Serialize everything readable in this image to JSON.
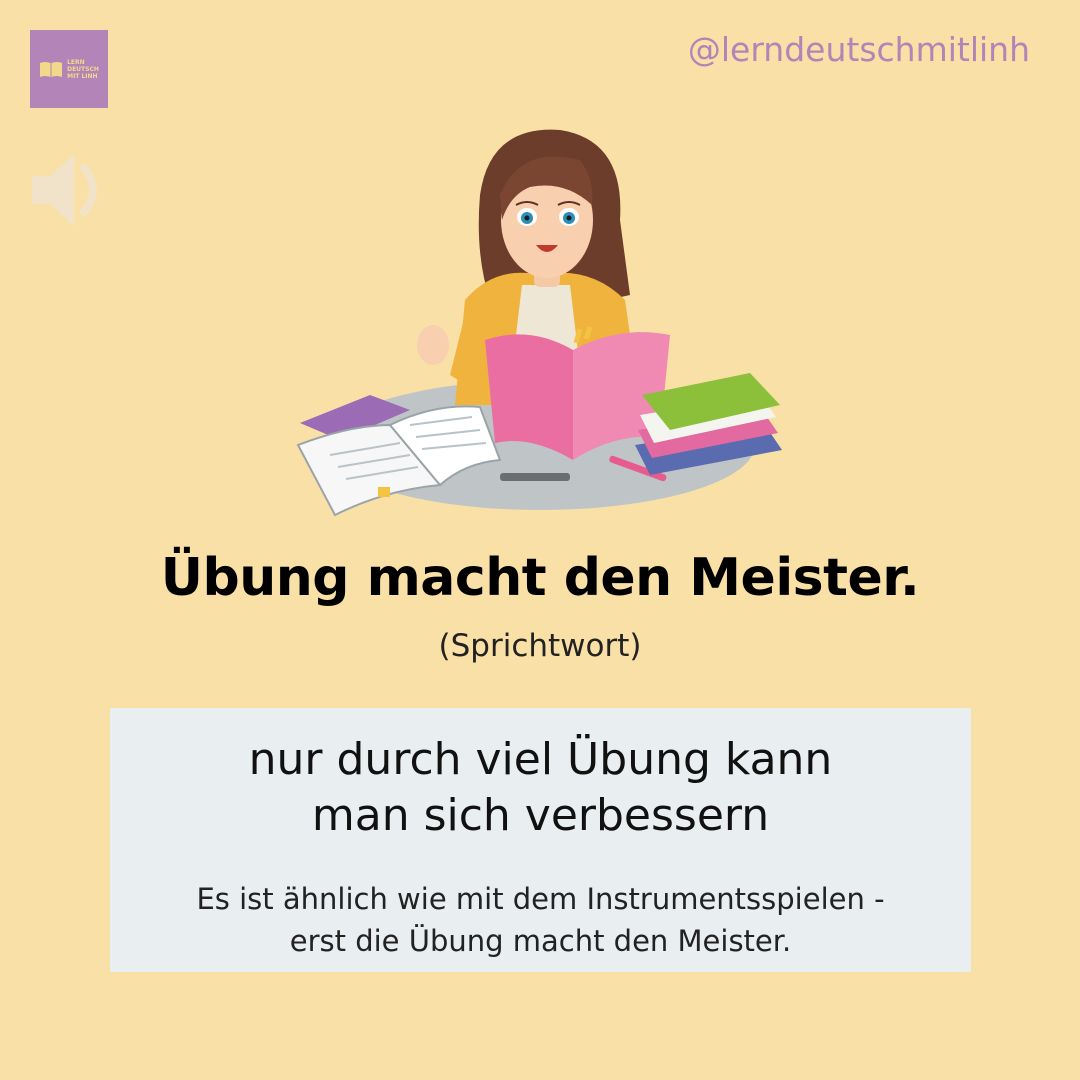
{
  "brand": {
    "logo_lines": [
      "LERN",
      "DEUTSCH",
      "MIT LINH"
    ],
    "handle": "@lerndeutschmitlinh"
  },
  "audio": {
    "icon": "speaker-icon"
  },
  "illustration": {
    "icon": "woman-reading-books-illustration"
  },
  "proverb": {
    "title": "Übung macht den Meister.",
    "type": "(Sprichtwort)"
  },
  "card": {
    "meaning_lines": [
      "nur durch viel Übung kann",
      "man sich verbessern"
    ],
    "explanation_lines": [
      "Es ist ähnlich wie mit dem Instrumentsspielen -",
      "erst die Übung macht den Meister."
    ]
  },
  "colors": {
    "background": "#f9e0a6",
    "accent": "#b384b8",
    "card": "#e9eef1"
  }
}
